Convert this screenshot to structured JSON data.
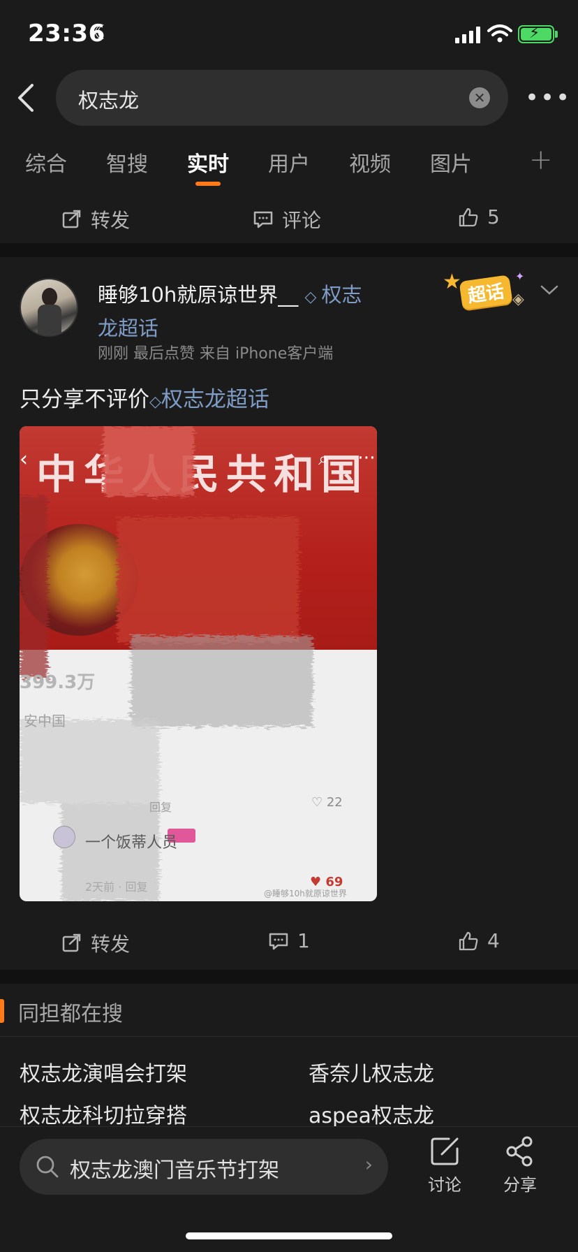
{
  "status_bar": {
    "time": "23:36"
  },
  "search": {
    "query": "权志龙"
  },
  "tabs": [
    {
      "label": "综合"
    },
    {
      "label": "智搜"
    },
    {
      "label": "实时"
    },
    {
      "label": "用户"
    },
    {
      "label": "视频"
    },
    {
      "label": "图片"
    }
  ],
  "prev_post_actions": {
    "repost": "转发",
    "comment": "评论",
    "like_count": "5"
  },
  "post": {
    "username": "睡够10h就原谅世界__",
    "topic": "权志龙超话",
    "topic_line1": "权志",
    "topic_line2": "龙超话",
    "meta": "刚刚 最后点赞   来自 iPhone客户端",
    "badge": "超话",
    "text": "只分享不评价",
    "text_topic": "权志龙超话",
    "image": {
      "title": "中华人民共和国",
      "count": "399.3万",
      "subtitle": "安中国",
      "reply": "回复",
      "likes": "22",
      "comment_user": "一个饭蒂人员",
      "time": "2天前 · 回复",
      "likes2": "69",
      "watermark": "@睡够10h就原谅世界"
    },
    "actions": {
      "repost": "转发",
      "comment_count": "1",
      "like_count": "4"
    }
  },
  "same_search": {
    "title": "同担都在搜",
    "items": [
      "权志龙演唱会打架",
      "香奈儿权志龙",
      "权志龙科切拉穿搭",
      "aspea权志龙"
    ]
  },
  "bottom_bar": {
    "search_text": "权志龙澳门音乐节打架",
    "discuss": "讨论",
    "share": "分享"
  },
  "colors": {
    "accent": "#ff7a1a",
    "link": "#7e9cc6",
    "background": "#1b1b1b"
  }
}
